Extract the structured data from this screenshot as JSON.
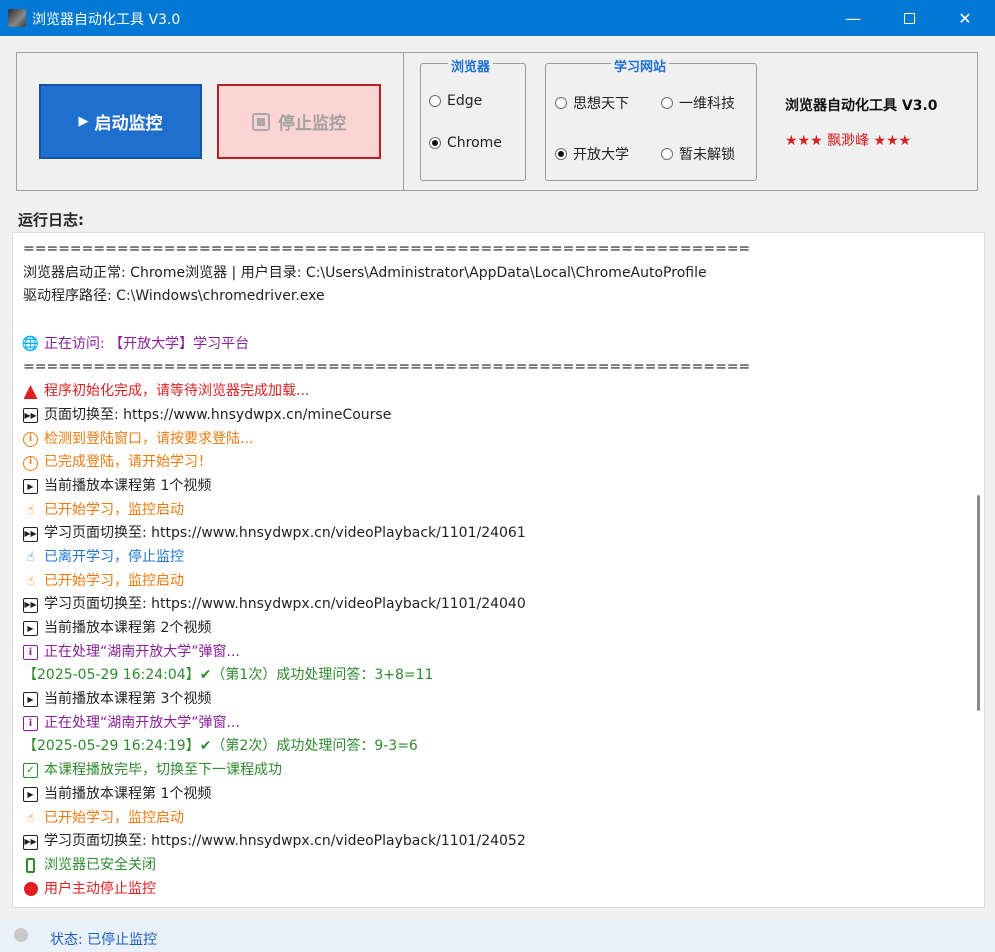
{
  "window": {
    "title": "浏览器自动化工具 V3.0",
    "minimize": "—",
    "close": "✕"
  },
  "controls": {
    "start_label": "启动监控",
    "start_glyph": "▶",
    "stop_label": "停止监控"
  },
  "browser_group": {
    "title": "浏览器",
    "options": [
      {
        "label": "Edge",
        "selected": false
      },
      {
        "label": "Chrome",
        "selected": true
      }
    ]
  },
  "site_group": {
    "title": "学习网站",
    "options": [
      {
        "label": "思想天下",
        "selected": false
      },
      {
        "label": "一维科技",
        "selected": false
      },
      {
        "label": "开放大学",
        "selected": true
      },
      {
        "label": "暂未解锁",
        "selected": false
      }
    ]
  },
  "brand": {
    "title": "浏览器自动化工具 V3.0",
    "author": "★★★ 飘渺峰 ★★★"
  },
  "log_label": "运行日志:",
  "log": [
    {
      "text": "==============================================================",
      "color": "dark",
      "icon": ""
    },
    {
      "text": "浏览器启动正常: Chrome浏览器 | 用户目录: C:\\Users\\Administrator\\AppData\\Local\\ChromeAutoProfile",
      "color": "dark",
      "icon": ""
    },
    {
      "text": "驱动程序路径: C:\\Windows\\chromedriver.exe",
      "color": "dark",
      "icon": ""
    },
    {
      "text": "",
      "color": "dark",
      "icon": ""
    },
    {
      "text": "正在访问: 【开放大学】学习平台",
      "color": "purple",
      "icon": "globe-icon"
    },
    {
      "text": "==============================================================",
      "color": "dark",
      "icon": ""
    },
    {
      "text": "程序初始化完成，请等待浏览器完成加载...",
      "color": "red",
      "icon": "alarm-icon"
    },
    {
      "text": "页面切换至: https://www.hnsydwpx.cn/mineCourse",
      "color": "dark",
      "icon": "fast-forward-icon"
    },
    {
      "text": "检测到登陆窗口，请按要求登陆...",
      "color": "orange",
      "icon": "info-circle-icon"
    },
    {
      "text": "已完成登陆，请开始学习！",
      "color": "orange",
      "icon": "info-circle-icon"
    },
    {
      "text": "当前播放本课程第 1个视频",
      "color": "dark",
      "icon": "play-icon"
    },
    {
      "text": "已开始学习，监控启动",
      "color": "orange",
      "icon": "hand-point-icon"
    },
    {
      "text": "学习页面切换至: https://www.hnsydwpx.cn/videoPlayback/1101/24061",
      "color": "dark",
      "icon": "fast-forward-icon"
    },
    {
      "text": "已离开学习，停止监控",
      "color": "blue",
      "icon": "hand-point-icon"
    },
    {
      "text": "已开始学习，监控启动",
      "color": "orange",
      "icon": "hand-point-icon"
    },
    {
      "text": "学习页面切换至: https://www.hnsydwpx.cn/videoPlayback/1101/24040",
      "color": "dark",
      "icon": "fast-forward-icon"
    },
    {
      "text": "当前播放本课程第 2个视频",
      "color": "dark",
      "icon": "play-icon"
    },
    {
      "text": "正在处理“湖南开放大学”弹窗...",
      "color": "purple",
      "icon": "info-box-icon"
    },
    {
      "text": "【2025-05-29 16:24:04】✔（第1次）成功处理问答：3+8=11",
      "color": "green",
      "icon": ""
    },
    {
      "text": "当前播放本课程第 3个视频",
      "color": "dark",
      "icon": "play-icon"
    },
    {
      "text": "正在处理“湖南开放大学”弹窗...",
      "color": "purple",
      "icon": "info-box-icon"
    },
    {
      "text": "【2025-05-29 16:24:19】✔（第2次）成功处理问答：9-3=6",
      "color": "green",
      "icon": ""
    },
    {
      "text": "本课程播放完毕，切换至下一课程成功",
      "color": "green",
      "icon": "check-box-icon"
    },
    {
      "text": "当前播放本课程第 1个视频",
      "color": "dark",
      "icon": "play-icon"
    },
    {
      "text": "已开始学习，监控启动",
      "color": "orange",
      "icon": "hand-point-icon"
    },
    {
      "text": "学习页面切换至: https://www.hnsydwpx.cn/videoPlayback/1101/24052",
      "color": "dark",
      "icon": "fast-forward-icon"
    },
    {
      "text": "浏览器已安全关闭",
      "color": "green",
      "icon": "phone-icon"
    },
    {
      "text": "用户主动停止监控",
      "color": "red",
      "icon": "stop-dot-icon"
    }
  ],
  "status": {
    "label": "状态: 已停止监控"
  },
  "colors": {
    "titlebar": "#0078d4",
    "accent_blue": "#1f6fcf",
    "stop_border": "#b82020",
    "group_title": "#1b6fd6"
  }
}
